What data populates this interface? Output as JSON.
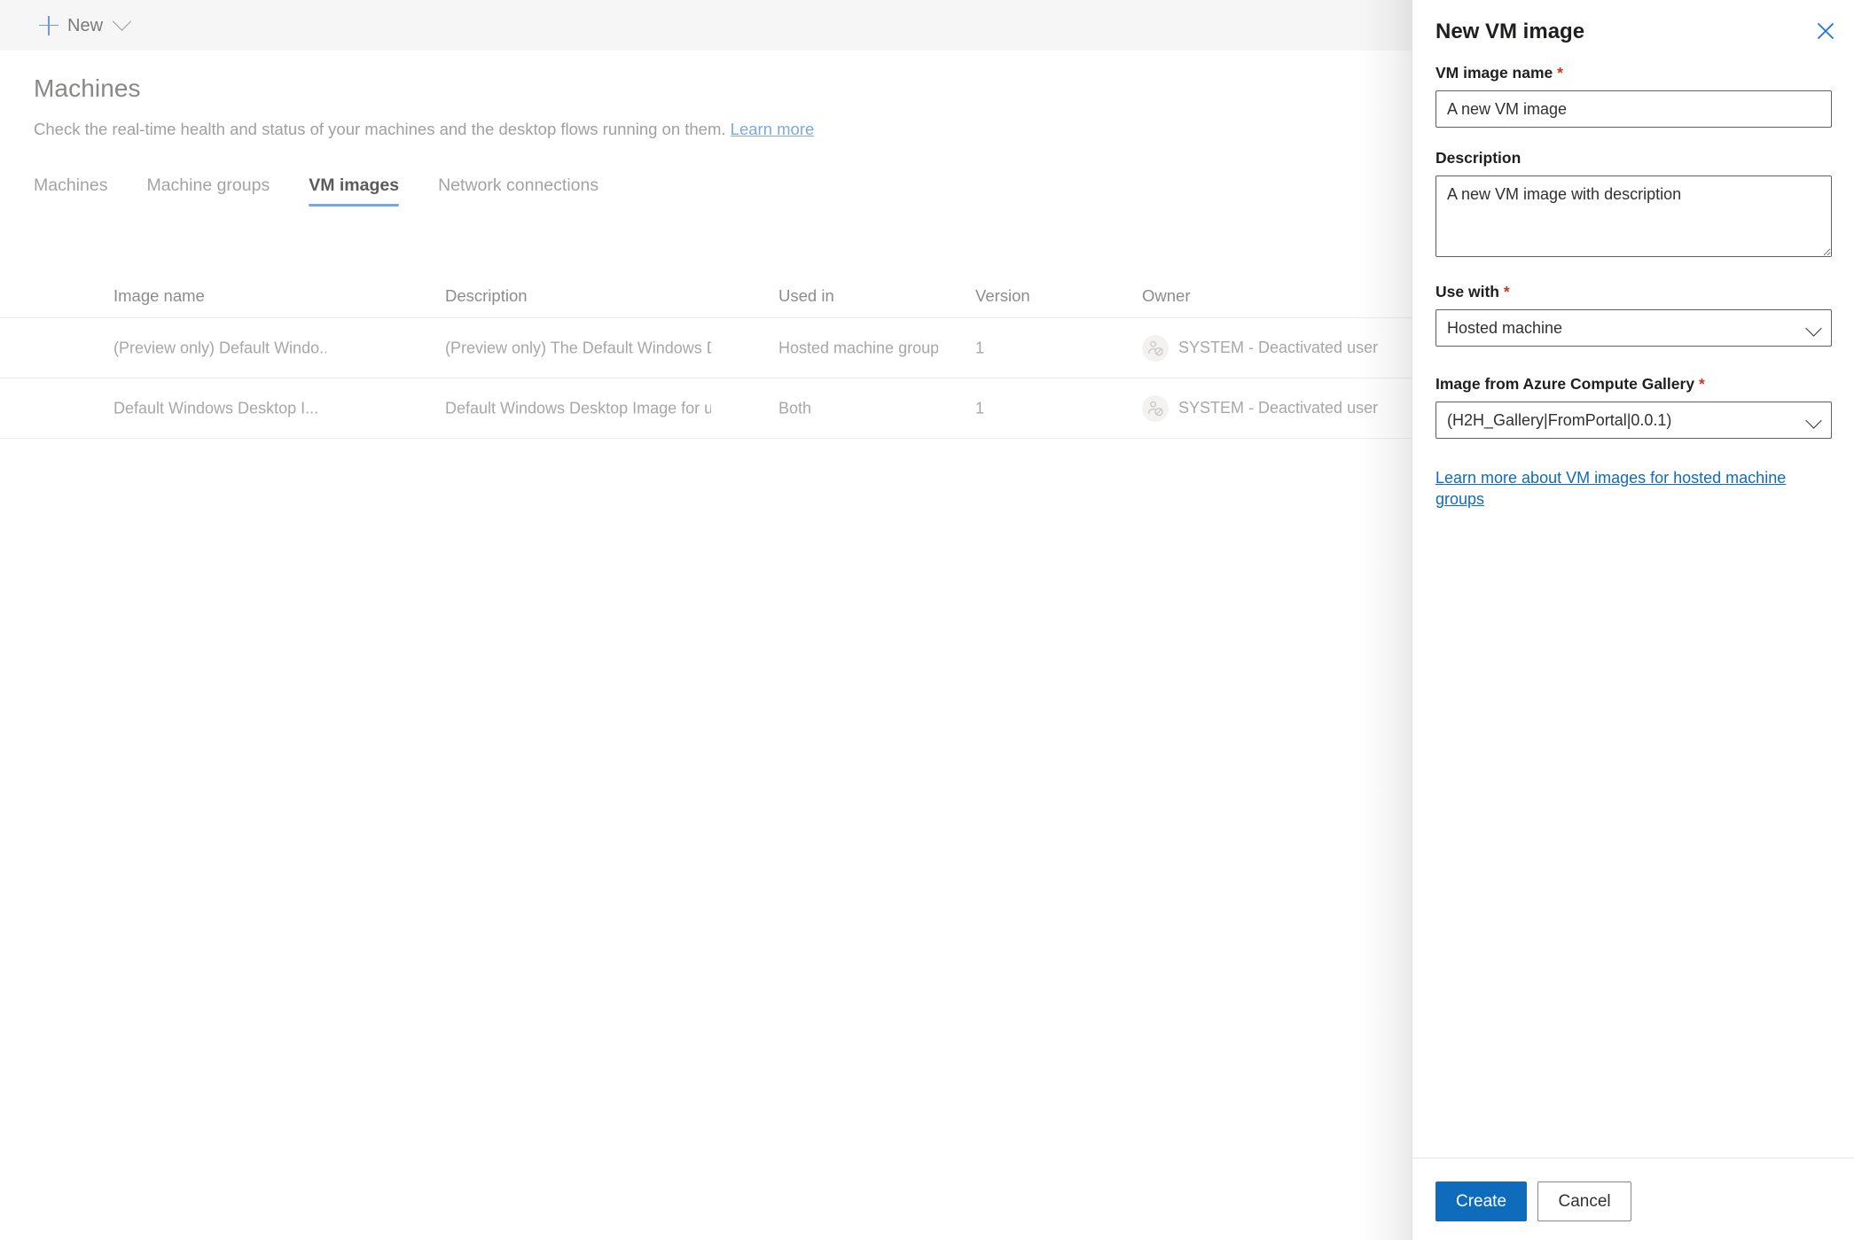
{
  "command_bar": {
    "new_label": "New",
    "plus_icon": "plus-icon",
    "chevron_icon": "chevron-down-icon"
  },
  "page": {
    "title": "Machines",
    "subtitle": "Check the real-time health and status of your machines and the desktop flows running on them.",
    "subtitle_link": "Learn more"
  },
  "tabs": [
    {
      "label": "Machines",
      "active": false
    },
    {
      "label": "Machine groups",
      "active": false
    },
    {
      "label": "VM images",
      "active": true
    },
    {
      "label": "Network connections",
      "active": false
    }
  ],
  "table": {
    "columns": [
      "Image name",
      "Description",
      "Used in",
      "Version",
      "Owner"
    ],
    "rows": [
      {
        "name": "(Preview only) Default Windo...",
        "description": "(Preview only) The Default Windows Desk...",
        "used_in": "Hosted machine group",
        "version": "1",
        "owner": "SYSTEM - Deactivated user",
        "owner_icon": "deactivated-user-icon"
      },
      {
        "name": "Default Windows Desktop I...",
        "description": "Default Windows Desktop Image for use i...",
        "used_in": "Both",
        "version": "1",
        "owner": "SYSTEM - Deactivated user",
        "owner_icon": "deactivated-user-icon"
      }
    ]
  },
  "panel": {
    "title": "New VM image",
    "close_icon": "close-icon",
    "fields": {
      "vm_image_name": {
        "label": "VM image name",
        "required": true,
        "value": "A new VM image",
        "placeholder": "A new VM image"
      },
      "description": {
        "label": "Description",
        "required": false,
        "value": "A new VM image with description",
        "placeholder": "A new VM image with description"
      },
      "use_with": {
        "label": "Use with",
        "required": true,
        "value": "Hosted machine",
        "chevron_icon": "chevron-down-icon"
      },
      "gallery_image": {
        "label": "Image from Azure Compute Gallery",
        "required": true,
        "value": "(H2H_Gallery|FromPortal|0.0.1)",
        "chevron_icon": "chevron-down-icon"
      }
    },
    "link": "Learn more about VM images for hosted machine groups",
    "create_label": "Create",
    "cancel_label": "Cancel"
  },
  "colors": {
    "accent": "#0f6cbd",
    "tab_underline": "#7aa5e8",
    "required_star": "#c0392b",
    "command_bar_bg": "#f6f6f6",
    "link": "#0f6cbd"
  }
}
